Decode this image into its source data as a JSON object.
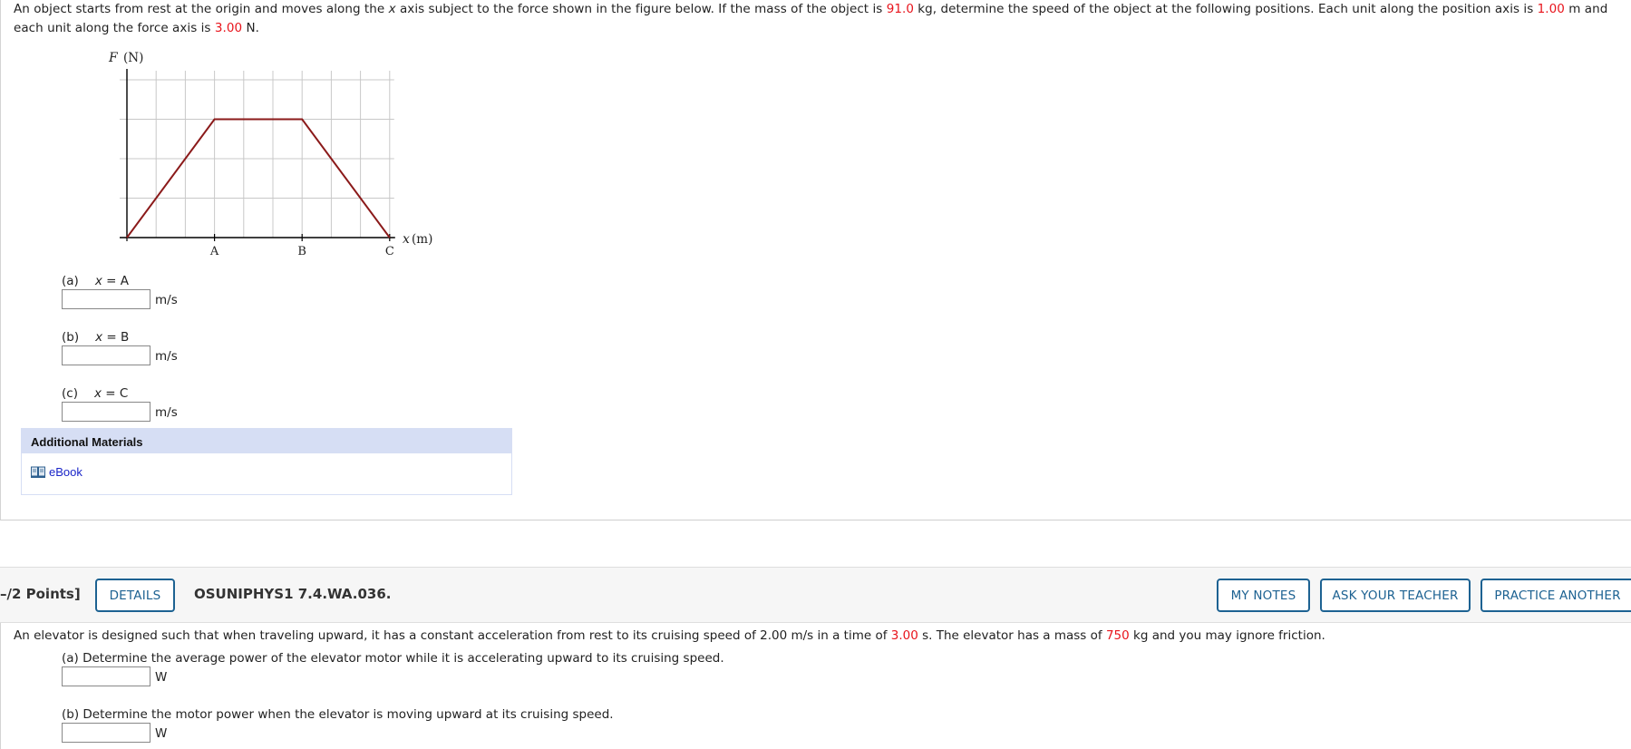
{
  "question1": {
    "prompt": {
      "text_1": "An object starts from rest at the origin and moves along the ",
      "var_x": "x",
      "text_2": " axis subject to the force shown in the figure below. If the mass of the object is ",
      "mass": "91.0",
      "text_3": " kg, determine the speed of the object at the following positions. Each unit along the position axis is ",
      "x_unit": "1.00",
      "text_4": " m and each unit along the force axis is ",
      "f_unit": "3.00",
      "text_5": " N."
    },
    "parts": [
      {
        "label": "(a)",
        "var": "x",
        "eq": " = A",
        "value": "",
        "unit": "m/s"
      },
      {
        "label": "(b)",
        "var": "x",
        "eq": " = B",
        "value": "",
        "unit": "m/s"
      },
      {
        "label": "(c)",
        "var": "x",
        "eq": " = C",
        "value": "",
        "unit": "m/s"
      }
    ],
    "additional_materials": {
      "title": "Additional Materials",
      "links": [
        {
          "label": "eBook",
          "icon": "book-icon"
        }
      ]
    }
  },
  "chart_data": {
    "type": "line",
    "title": "",
    "ylabel_var": "F",
    "ylabel_unit": "(N)",
    "xlabel_var": "x",
    "xlabel_unit": "(m)",
    "xlim": [
      0,
      9
    ],
    "ylim": [
      0,
      4
    ],
    "grid": true,
    "x_grid_step": 1,
    "y_grid_step": 1,
    "x_tick_labels": [
      {
        "x": 3,
        "label": "A"
      },
      {
        "x": 6,
        "label": "B"
      },
      {
        "x": 9,
        "label": "C"
      }
    ],
    "series": [
      {
        "name": "F(x)",
        "color": "#8b1a1a",
        "points": [
          [
            0,
            0
          ],
          [
            3,
            3
          ],
          [
            6,
            3
          ],
          [
            9,
            0
          ]
        ]
      }
    ]
  },
  "question2": {
    "points": "–/2 Points]",
    "buttons": {
      "details": "DETAILS",
      "my_notes": "MY NOTES",
      "ask_teacher": "ASK YOUR TEACHER",
      "practice_another": "PRACTICE ANOTHER"
    },
    "question_id": "OSUNIPHYS1 7.4.WA.036.",
    "prompt": {
      "text_1": "An elevator is designed such that when traveling upward, it has a constant acceleration from rest to its cruising speed of 2.00 m/s in a time of ",
      "time": "3.00",
      "text_2": " s. The elevator has a mass of ",
      "mass": "750",
      "text_3": " kg and you may ignore friction."
    },
    "parts": [
      {
        "label": "(a) Determine the average power of the elevator motor while it is accelerating upward to its cruising speed.",
        "value": "",
        "unit": "W"
      },
      {
        "label": "(b) Determine the motor power when the elevator is moving upward at its cruising speed.",
        "value": "",
        "unit": "W"
      }
    ]
  },
  "colors": {
    "accent_red": "#e8141c",
    "button_blue": "#1d6292",
    "link_blue": "#1a25c8",
    "materials_bg": "#d6def4",
    "graph_line": "#8b1a1a"
  }
}
